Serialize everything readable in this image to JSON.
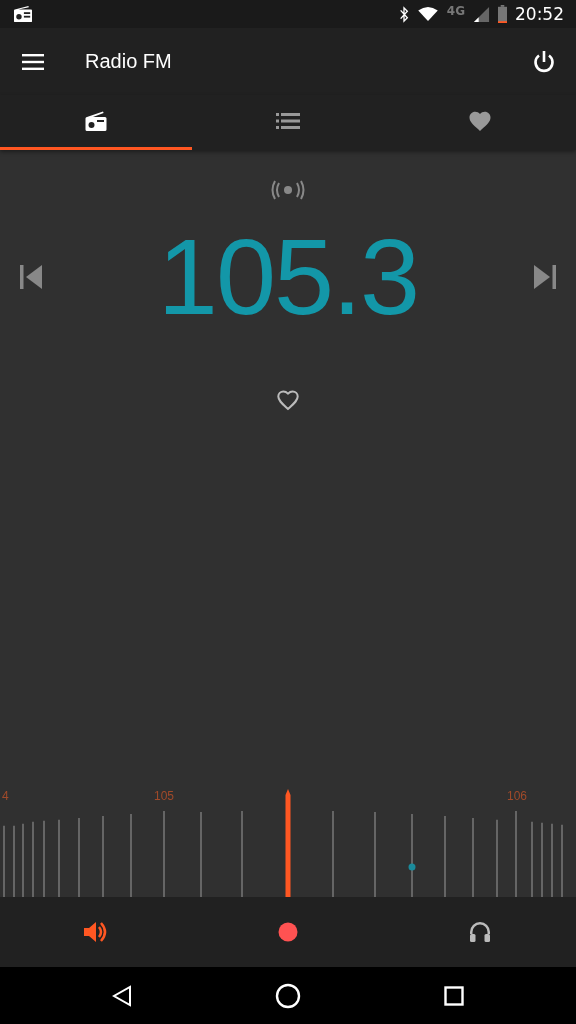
{
  "status_bar": {
    "network": "4G",
    "time": "20:52"
  },
  "app_bar": {
    "title": "Radio FM"
  },
  "tabs": [
    {
      "kind": "radio",
      "selected": true
    },
    {
      "kind": "list",
      "selected": false
    },
    {
      "kind": "favorites",
      "selected": false
    }
  ],
  "station": {
    "frequency": "105.3",
    "favorite": false
  },
  "tuner": {
    "labels": [
      "4",
      "105",
      "106"
    ]
  },
  "bottom_bar": [
    {
      "kind": "speaker",
      "on": true
    },
    {
      "kind": "record",
      "on": false
    },
    {
      "kind": "headphones",
      "on": false
    }
  ]
}
